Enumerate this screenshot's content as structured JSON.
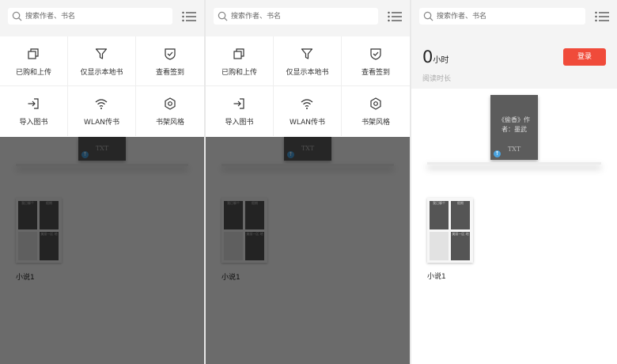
{
  "search": {
    "placeholder": "搜索作者、书名"
  },
  "menu": [
    {
      "label": "已购和上传",
      "icon": "copy-icon"
    },
    {
      "label": "仅显示本地书",
      "icon": "filter-icon"
    },
    {
      "label": "查看签到",
      "icon": "check-shield-icon"
    },
    {
      "label": "导入图书",
      "icon": "import-icon"
    },
    {
      "label": "WLAN传书",
      "icon": "wifi-icon"
    },
    {
      "label": "书架风格",
      "icon": "settings-icon"
    }
  ],
  "shelf_book": {
    "title_line1": "《偷香》作",
    "title_line2": "者：墨武",
    "format": "TXT"
  },
  "folder": {
    "label": "小说1",
    "books": [
      "我已聊个",
      "假期",
      "",
      "美丽一区 地"
    ]
  },
  "profile": {
    "reading_time_value": "0",
    "reading_time_unit": "小时",
    "reading_time_label": "阅读时长",
    "login_label": "登录"
  },
  "colors": {
    "accent": "#f04b3a",
    "badge": "#4aa3e0"
  }
}
